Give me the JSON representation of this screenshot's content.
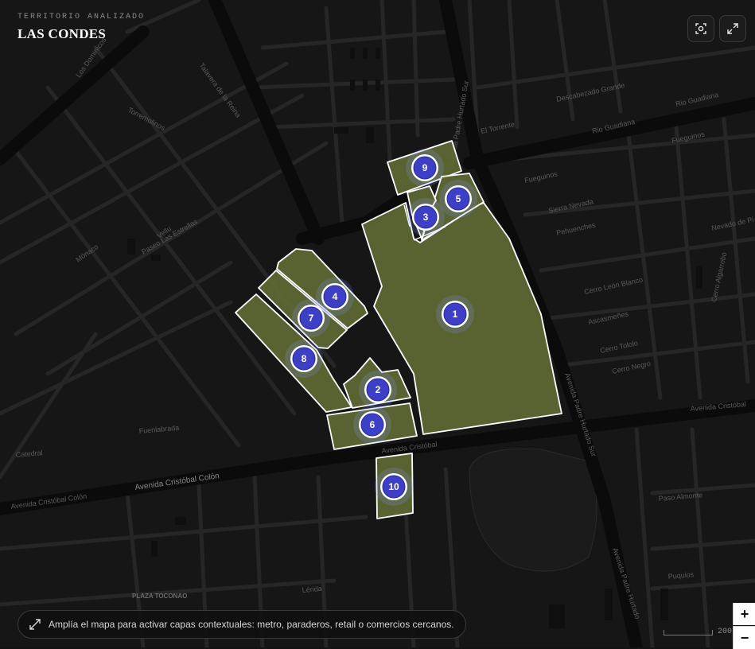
{
  "header": {
    "kicker": "TERRITORIO ANALIZADO",
    "title": "LAS CONDES"
  },
  "controls": {
    "focus_icon": "focus-scan-icon",
    "expand_icon": "expand-icon",
    "zoom_in": "+",
    "zoom_out": "−"
  },
  "hint": {
    "icon": "expand-diagonal-icon",
    "text": "Amplía el mapa para activar capas contextuales: metro, paraderos, retail o comercios cercanos."
  },
  "scale": {
    "label": "200"
  },
  "streets": {
    "avenida_colon_left": "Avenida Cristóbal Colón",
    "avenida_colon_mid": "Avenida Cristóbal Colón",
    "avenida_colon_right": "Avenida Cristóbal",
    "rio_guadiana": "Rio Guadiana",
    "rio_guadiana_2": "Rio Guadiana",
    "talavera": "Talavera de la Reina",
    "los_dominicos": "Los Dominicos",
    "padre_hurtado_sur": "Avenida Padre Hurtado Sur",
    "padre_hurtado_top": "Avenida Padre Hurtado Sur",
    "padre_hurtado_bottom": "Avenida Padre Hurtado",
    "fuegueinos": "Fueguinos",
    "fuegueinos_2": "Fueguinos",
    "sierra_nevada": "Sierra Nevada",
    "pehuenches": "Pehuenches",
    "nevado_de_piuquenes": "Nevado de Pi",
    "cerro_leon_blanco": "Cerro León Blanco",
    "ascamenes": "Ascasmeñes",
    "cerro_tololo": "Cerro Tololo",
    "cerro_negro": "Cerro Negro",
    "el_torrente": "El Torrente",
    "descabezado": "Descabezado Grande",
    "torremolinos": "Torremolinos",
    "paseo_las_estrellas": "Paseo Las Estrellas",
    "plaza_toconao": "PLAZA TOCONAO",
    "lerida": "Lérida",
    "puquios": "Puquios",
    "paso_almonte": "Paso Almonte",
    "cerro_algarrobo": "Cerro Algarrobo",
    "monaco": "Mónaco",
    "vellu": "Vellu",
    "catedral": "Catedral",
    "fuenlabrada": "Fuenlabrada"
  },
  "parcels": [
    {
      "id": "1",
      "label": "1"
    },
    {
      "id": "2",
      "label": "2"
    },
    {
      "id": "3",
      "label": "3"
    },
    {
      "id": "4",
      "label": "4"
    },
    {
      "id": "5",
      "label": "5"
    },
    {
      "id": "6",
      "label": "6"
    },
    {
      "id": "7",
      "label": "7"
    },
    {
      "id": "8",
      "label": "8"
    },
    {
      "id": "9",
      "label": "9"
    },
    {
      "id": "10",
      "label": "10"
    }
  ],
  "colors": {
    "background": "#141414",
    "parcel_fill": "#5f6a35",
    "parcel_stroke": "#ffffff",
    "marker": "#3e3fc7"
  }
}
